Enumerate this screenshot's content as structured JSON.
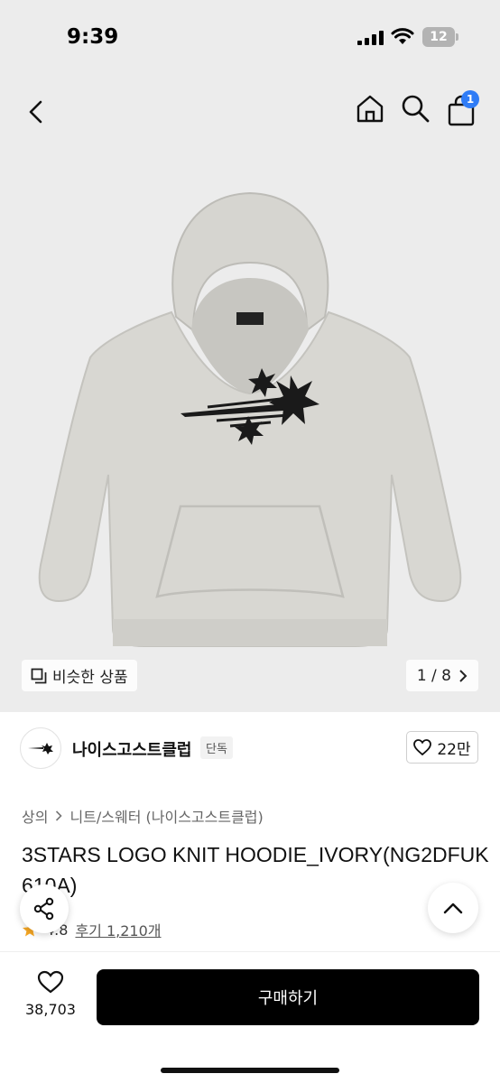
{
  "status_bar": {
    "time": "9:39",
    "battery": "12"
  },
  "nav": {
    "cart_count": "1",
    "icons": [
      "back-arrow-icon",
      "home-icon",
      "search-icon",
      "cart-icon"
    ]
  },
  "gallery": {
    "similar_label": "비슷한 상품",
    "page": "1 / 8"
  },
  "brand": {
    "name": "나이스고스트클럽",
    "tag": "단독",
    "likes": "22만"
  },
  "product": {
    "breadcrumb": [
      "상의",
      "니트/스웨터 (나이스고스트클럽)"
    ],
    "title": "3STARS LOGO KNIT HOODIE_IVORY(NG2DFUK610A)",
    "rating": "4.8",
    "reviews": "후기 1,210개"
  },
  "bottom_bar": {
    "wish_count": "38,703",
    "buy_label": "구매하기"
  },
  "colors": {
    "accent_badge": "#2f7cf6",
    "buy_button": "#000000",
    "star": "#f5a623",
    "image_bg": "#ececec"
  }
}
